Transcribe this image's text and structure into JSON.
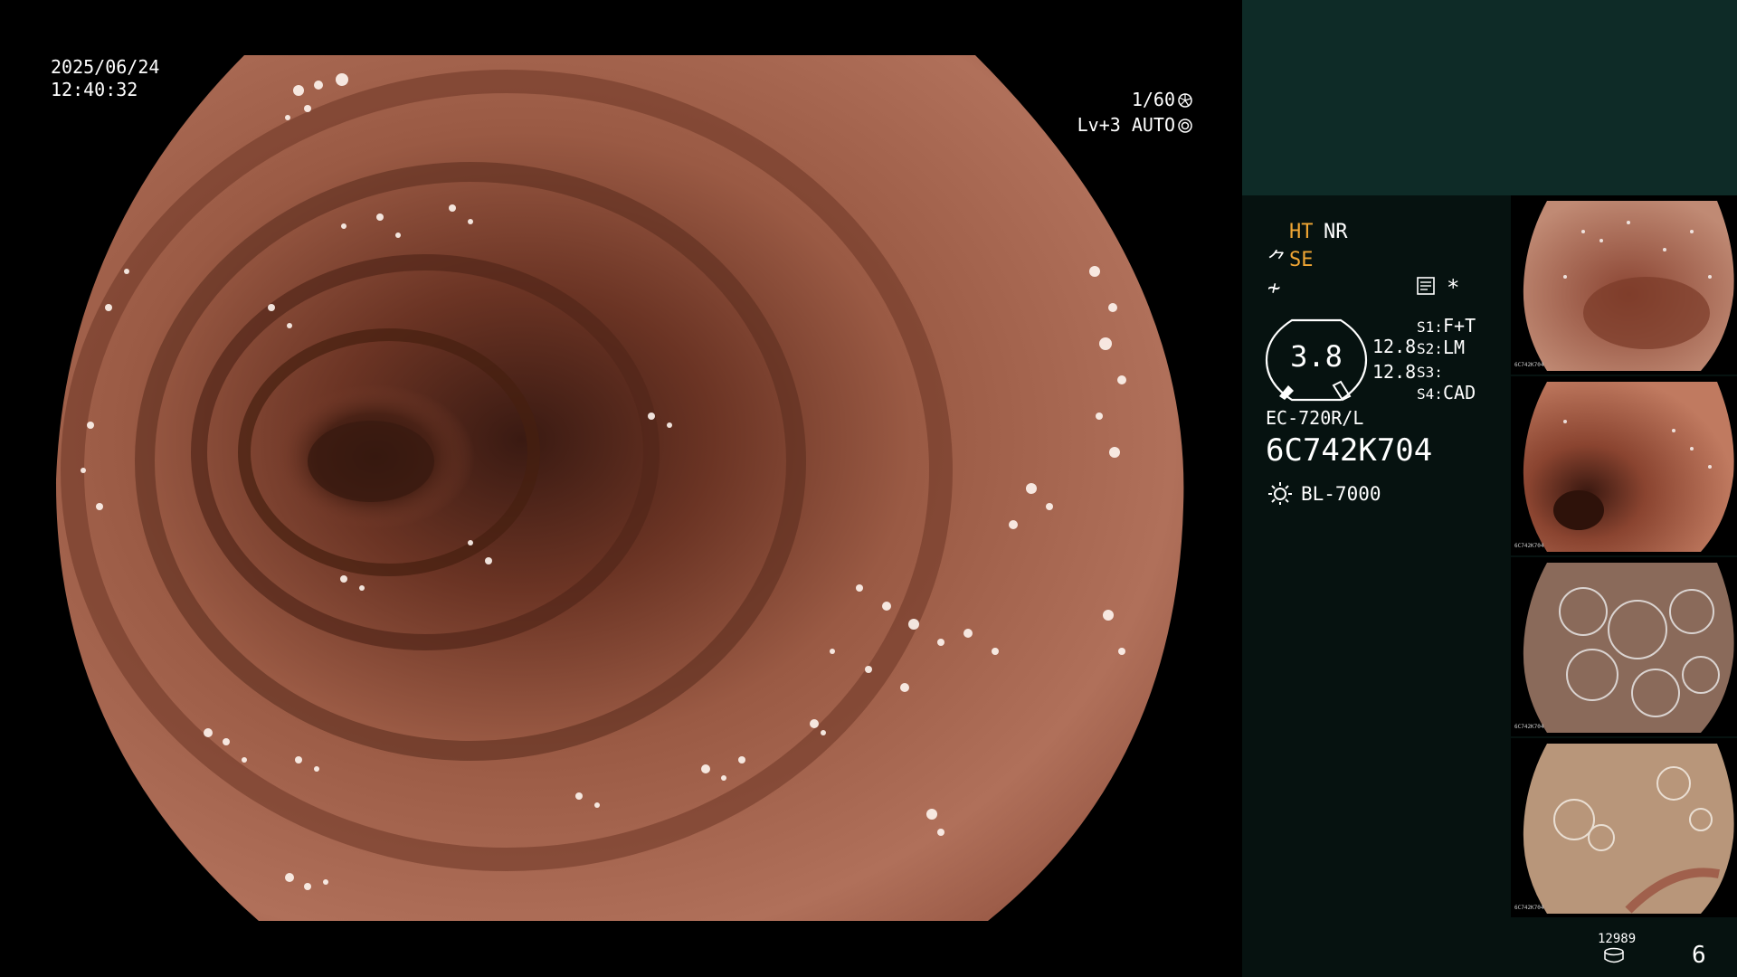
{
  "osd": {
    "date": "2025/06/24",
    "time": "12:40:32",
    "shutter": "1/60",
    "shutter_icon": "shutter-icon",
    "level": "Lv+3 AUTO",
    "iris_icon": "iris-icon"
  },
  "panel": {
    "modes": {
      "ht": "HT",
      "nr": "NR",
      "se": "SE",
      "se_icon": "tube-icon",
      "f_icon": "frequency-icon",
      "memo_icon": "memo-icon",
      "star": "*"
    },
    "gauge": {
      "value": "3.8",
      "row1": "12.8",
      "row2": "12.8"
    },
    "switches": [
      {
        "label": "S1:",
        "value": "F+T"
      },
      {
        "label": "S2:",
        "value": "LM"
      },
      {
        "label": "S3:",
        "value": ""
      },
      {
        "label": "S4:",
        "value": "CAD"
      }
    ],
    "scope_model": "EC-720R/L",
    "scope_serial": "6C742K704",
    "light_icon": "light-source-icon",
    "light_model": "BL-7000",
    "thumbnails": [
      {
        "name": "thumb-1",
        "serial": "6C742K704"
      },
      {
        "name": "thumb-2",
        "serial": "6C742K704"
      },
      {
        "name": "thumb-3",
        "serial": "6C742K704"
      },
      {
        "name": "thumb-4",
        "serial": "6C742K704"
      }
    ],
    "image_count": "12989",
    "disk_icon": "disk-icon",
    "page": "6"
  },
  "colors": {
    "accent_orange": "#f0a634",
    "panel_top": "#0e2b27",
    "panel_body": "#061210",
    "mucosa": "#a8624c"
  }
}
